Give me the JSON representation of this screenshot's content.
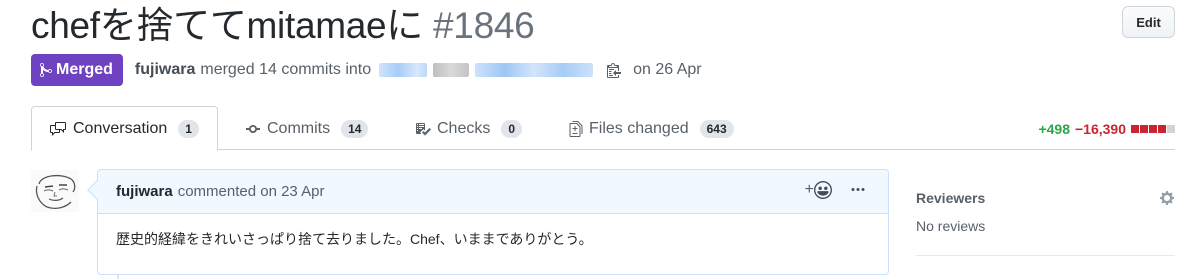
{
  "pr": {
    "title": "chefを捨ててmitamaeに",
    "number": "#1846",
    "edit_label": "Edit",
    "state": "Merged",
    "author": "fujiwara",
    "merge_text": "merged 14 commits into",
    "date_text": "on 26 Apr"
  },
  "tabs": [
    {
      "label": "Conversation",
      "count": "1"
    },
    {
      "label": "Commits",
      "count": "14"
    },
    {
      "label": "Checks",
      "count": "0"
    },
    {
      "label": "Files changed",
      "count": "643"
    }
  ],
  "diffstat": {
    "additions": "+498",
    "deletions": "−16,390"
  },
  "comment": {
    "author": "fujiwara",
    "meta": "commented on 23 Apr",
    "reaction_label": "+",
    "body": "歴史的経緯をきれいさっぱり捨て去りました。Chef、いままでありがとう。"
  },
  "sidebar": {
    "reviewers_title": "Reviewers",
    "reviewers_empty": "No reviews"
  },
  "colors": {
    "merged": "#6f42c1",
    "added": "#28a745",
    "deleted": "#cb2431",
    "comment_header_bg": "#f1f8ff"
  },
  "icons": [
    "git-merge-icon",
    "copy-icon",
    "comment-discussion-icon",
    "git-commit-icon",
    "checklist-icon",
    "file-diff-icon",
    "smiley-icon",
    "kebab-horizontal-icon",
    "gear-icon"
  ]
}
